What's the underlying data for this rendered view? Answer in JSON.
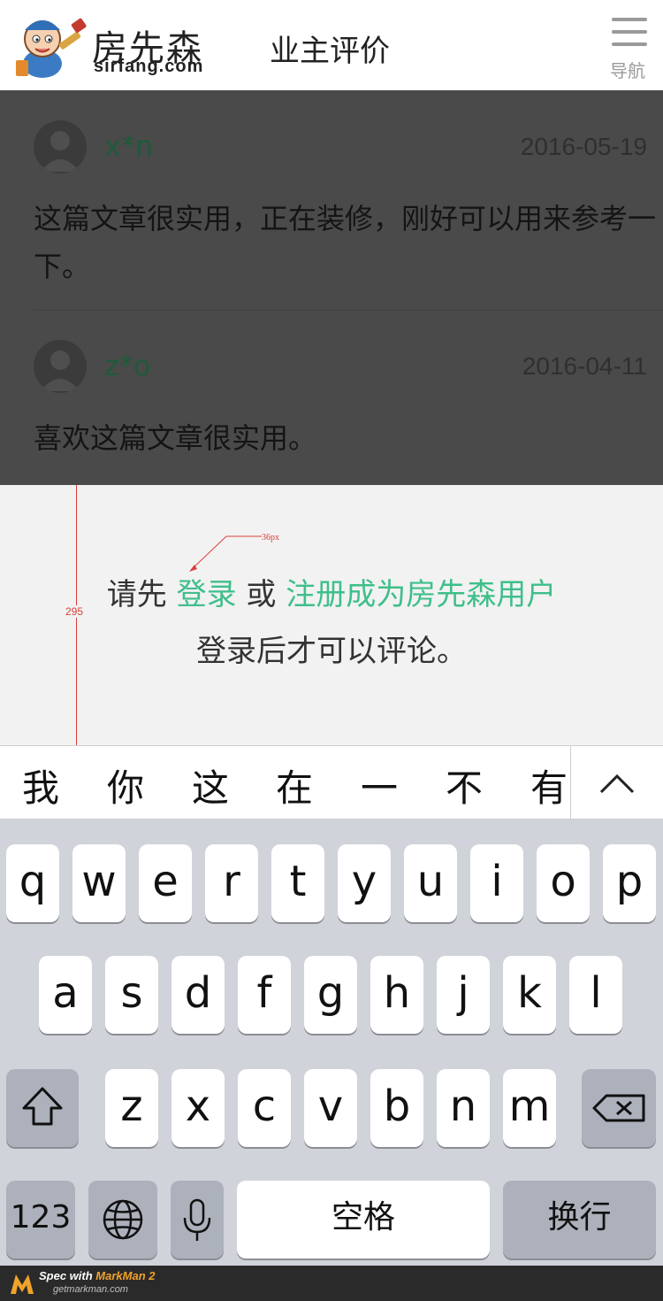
{
  "header": {
    "logo_cn": "房先森",
    "logo_en": "sirfang.com",
    "title": "业主评价",
    "nav_label": "导航"
  },
  "comments": [
    {
      "user": "x*n",
      "date": "2016-05-19",
      "text": "这篇文章很实用，正在装修，刚好可以用来参考一下。"
    },
    {
      "user": "z*o",
      "date": "2016-04-11",
      "text": "喜欢这篇文章很实用。"
    }
  ],
  "login": {
    "prefix": "请先",
    "login_link": "登录",
    "or": "或",
    "register_link": "注册成为房先森用户",
    "note": "登录后才可以评论。"
  },
  "spec": {
    "height_label": "295",
    "font_label": "36px"
  },
  "candidates": [
    "我",
    "你",
    "这",
    "在",
    "一",
    "不",
    "有"
  ],
  "keyboard": {
    "row1": [
      "q",
      "w",
      "e",
      "r",
      "t",
      "y",
      "u",
      "i",
      "o",
      "p"
    ],
    "row2": [
      "a",
      "s",
      "d",
      "f",
      "g",
      "h",
      "j",
      "k",
      "l"
    ],
    "row3": [
      "z",
      "x",
      "c",
      "v",
      "b",
      "n",
      "m"
    ],
    "numbers_label": "123",
    "space_label": "空格",
    "return_label": "换行"
  },
  "footer": {
    "spec_with": "Spec with ",
    "app_name": "MarkMan 2",
    "url": "getmarkman.com"
  },
  "colors": {
    "accent_green": "#3fbf8a",
    "overlay": "#4a4a4a",
    "keyboard_bg": "#d0d3da",
    "spec_red": "#d9403a"
  }
}
